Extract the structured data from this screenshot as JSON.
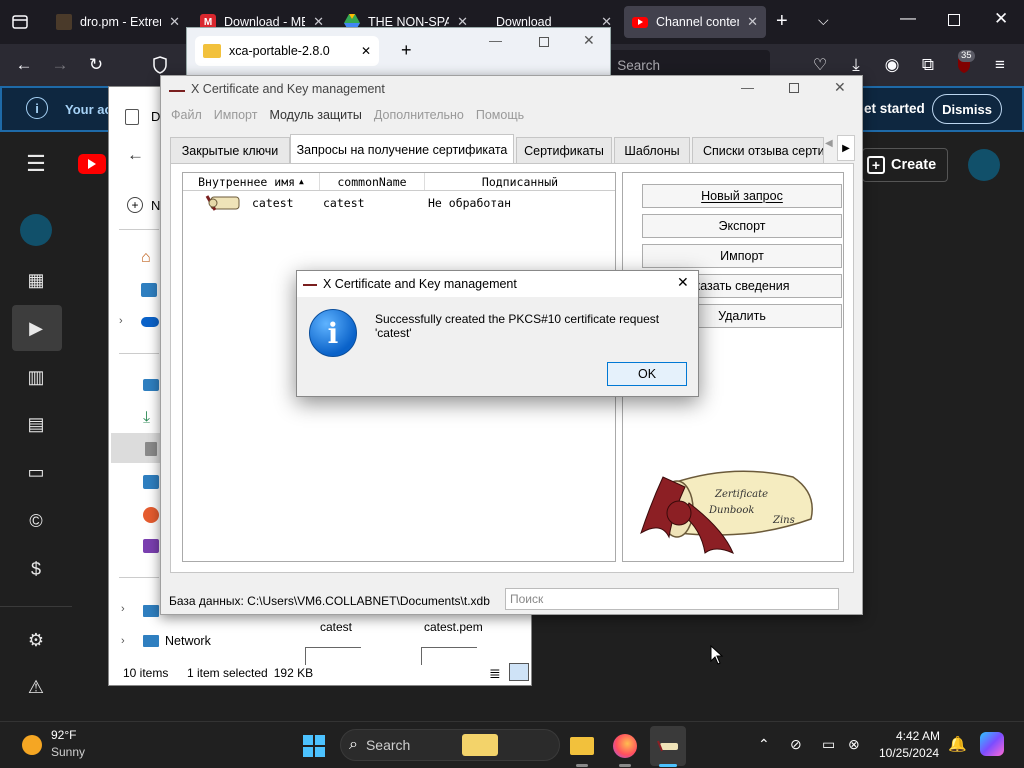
{
  "browser": {
    "tabs": [
      {
        "title": "dro.pm - Extrem",
        "favicon": "dropm-icon"
      },
      {
        "title": "Download - MEG",
        "favicon": "mega-icon"
      },
      {
        "title": "THE NON-SPAM",
        "favicon": "drive-icon"
      },
      {
        "title": "Download",
        "favicon": "doc-icon"
      },
      {
        "title": "Channel content",
        "favicon": "youtube-icon"
      }
    ],
    "search_placeholder": "Search",
    "notification_count": "35",
    "banner_text": "Your ac",
    "banner_get_started": "et started",
    "banner_dismiss": "Dismiss"
  },
  "youtube": {
    "create_label": "Create"
  },
  "explorer": {
    "title": "D",
    "new_label": "N",
    "nav_network": "Network",
    "file1": "catest",
    "file2": "catest.pem",
    "status_items": "10 items",
    "status_selected": "1 item selected",
    "status_size": "192 KB"
  },
  "xca_tab": {
    "title": "xca-portable-2.8.0"
  },
  "xca": {
    "title": "X Certificate and Key management",
    "menu": [
      "Файл",
      "Импорт",
      "Модуль защиты",
      "Дополнительно",
      "Помощь"
    ],
    "tabs": [
      "Закрытые ключи",
      "Запросы на получение сертификата",
      "Сертификаты",
      "Шаблоны",
      "Списки отзыва сертис"
    ],
    "columns": [
      "Внутреннее имя",
      "commonName",
      "Подписанный"
    ],
    "rows": [
      {
        "name": "catest",
        "cn": "catest",
        "signed": "Не обработан"
      }
    ],
    "buttons": [
      "Новый запрос",
      "Экспорт",
      "Импорт",
      "казать сведения",
      "Удалить"
    ],
    "db_label": "База данных: C:\\Users\\VM6.COLLABNET\\Documents\\t.xdb",
    "search_placeholder": "Поиск",
    "scroll_text": {
      "line1": "Zertificate",
      "line2": "Dunbook",
      "line3": "Zins"
    }
  },
  "dialog": {
    "title": "X Certificate and Key management",
    "message": "Successfully created the PKCS#10 certificate request 'catest'",
    "ok": "OK"
  },
  "taskbar": {
    "weather_temp": "92°F",
    "weather_desc": "Sunny",
    "search_label": "Search",
    "time": "4:42 AM",
    "date": "10/25/2024"
  },
  "colors": {
    "accent": "#0078d4",
    "browser_bg": "#1c1b22",
    "banner": "#0e2740",
    "youtube_red": "#ff0000"
  }
}
